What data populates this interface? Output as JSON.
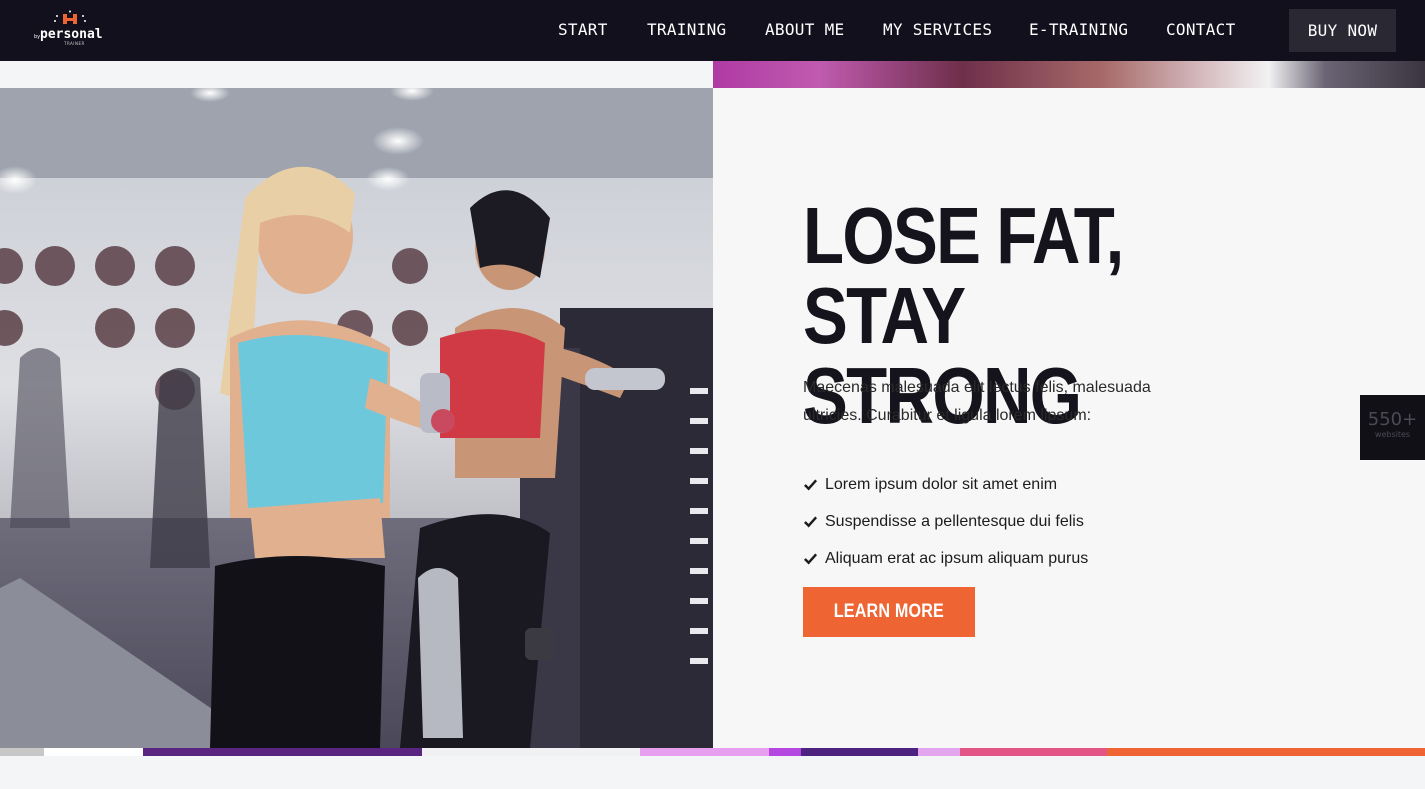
{
  "brand": {
    "logo_text": "personal",
    "logo_prefix": "by",
    "logo_tag": "TRAINER",
    "accent": "#ee6433"
  },
  "nav": {
    "items": [
      {
        "label": "START"
      },
      {
        "label": "TRAINING"
      },
      {
        "label": "ABOUT ME"
      },
      {
        "label": "MY SERVICES"
      },
      {
        "label": "E-TRAINING"
      },
      {
        "label": "CONTACT"
      }
    ],
    "cta": "BUY NOW"
  },
  "hero": {
    "headline_line1": "LOSE FAT,",
    "headline_line2": "STAY STRONG",
    "intro": "Maecenas malesuada elit lectus felis, malesuada ultricies. Curabitur et ligula lorem lipsum:",
    "bullets": [
      "Lorem ipsum dolor sit amet enim",
      "Suspendisse a pellentesque dui felis",
      "Aliquam erat ac ipsum aliquam purus"
    ],
    "button": "LEARN MORE"
  },
  "badge": {
    "count": "550+",
    "label": "websites"
  },
  "colors": {
    "header_bg": "#12101c",
    "panel_bg": "#f7f7f7",
    "button_bg": "#ee6433"
  }
}
